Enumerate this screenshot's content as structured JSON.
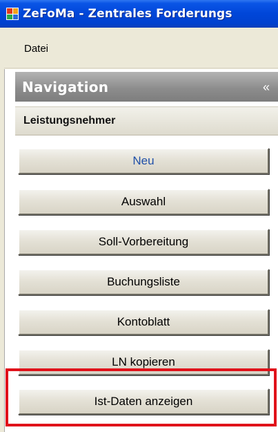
{
  "window": {
    "title": "ZeFoMa - Zentrales Forderungs"
  },
  "menu": {
    "items": [
      {
        "label": "Datei"
      }
    ]
  },
  "navigation": {
    "title": "Navigation",
    "collapse_glyph": "«",
    "section": {
      "title": "Leistungsnehmer",
      "buttons": [
        {
          "label": "Neu"
        },
        {
          "label": "Auswahl"
        },
        {
          "label": "Soll-Vorbereitung"
        },
        {
          "label": "Buchungsliste"
        },
        {
          "label": "Kontoblatt"
        },
        {
          "label": "LN kopieren"
        },
        {
          "label": "Ist-Daten anzeigen"
        }
      ]
    }
  },
  "colors": {
    "titlebar": "#0046d8",
    "nav_header": "#8d8d8d",
    "highlight": "#e0121a",
    "active_button_text": "#1f4fa8"
  }
}
